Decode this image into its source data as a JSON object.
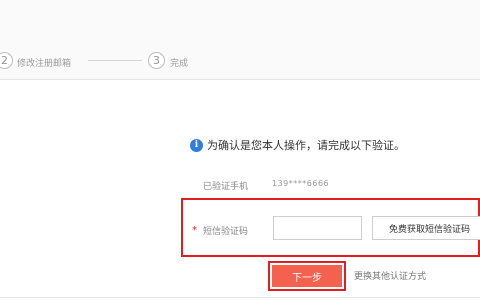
{
  "steps": [
    {
      "number": "2",
      "label": "修改注册邮箱"
    },
    {
      "number": "3",
      "label": "完成"
    }
  ],
  "verification": {
    "tip": "为确认是您本人操作，请完成以下验证。",
    "phone_label": "已验证手机",
    "phone_value": "139****6666",
    "required_mark": "*",
    "sms_label": "短信验证码",
    "sms_value": "",
    "sms_placeholder": "",
    "get_code_label": "免费获取短信验证码",
    "next_label": "下一步",
    "other_method_label": "更换其他认证方式"
  },
  "colors": {
    "accent": "#f5614f",
    "highlight_border": "#e02020",
    "info": "#2d7ee0"
  }
}
